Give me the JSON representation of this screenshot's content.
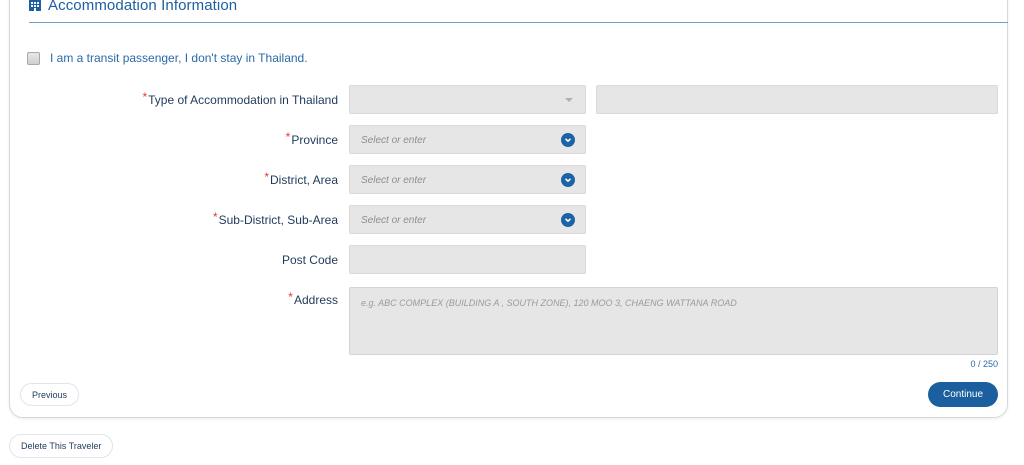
{
  "section": {
    "title": "Accommodation Information",
    "icon": "building-icon",
    "accent": "#1d5fa0"
  },
  "transit": {
    "label": "I am a transit passenger, I don't stay in Thailand.",
    "checked": false
  },
  "fields": {
    "accommodation_type": {
      "required_mark": "*",
      "label": "Type of Accommodation in Thailand",
      "value": "",
      "detail_value": ""
    },
    "province": {
      "required_mark": "*",
      "label": "Province",
      "placeholder": "Select or enter"
    },
    "district": {
      "required_mark": "*",
      "label": "District, Area",
      "placeholder": "Select or enter"
    },
    "sub_district": {
      "required_mark": "*",
      "label": "Sub-District, Sub-Area",
      "placeholder": "Select or enter"
    },
    "post_code": {
      "label": "Post Code",
      "value": ""
    },
    "address": {
      "required_mark": "*",
      "label": "Address",
      "placeholder": "e.g. ABC COMPLEX (BUILDING A , SOUTH ZONE), 120 MOO 3, CHAENG WATTANA ROAD",
      "counter": "0 / 250"
    }
  },
  "actions": {
    "previous": "Previous",
    "continue": "Continue",
    "delete_traveler": "Delete This Traveler"
  },
  "colors": {
    "primary": "#1b5f9e",
    "required": "#e53935",
    "field_bg": "#e6e6e6"
  }
}
